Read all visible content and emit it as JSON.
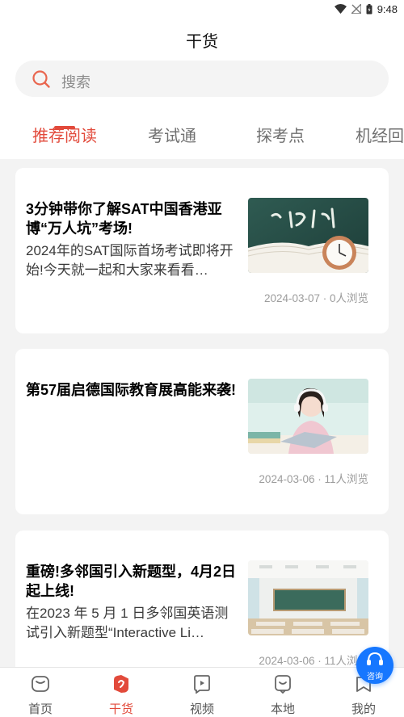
{
  "status_bar": {
    "time": "9:48"
  },
  "header": {
    "title": "干货"
  },
  "search": {
    "placeholder": "搜索"
  },
  "tabs": [
    {
      "label": "推荐阅读",
      "active": true
    },
    {
      "label": "考试通",
      "active": false
    },
    {
      "label": "探考点",
      "active": false
    },
    {
      "label": "机经回",
      "active": false
    }
  ],
  "articles": [
    {
      "title": "3分钟带你了解SAT中国香港亚博“万人坑”考场!",
      "desc": "2024年的SAT国际首场考试即将开始!今天就一起和大家来看看…",
      "meta": "2024-03-07 · 0人浏览",
      "thumb": "chalkboard-clock-image"
    },
    {
      "title": "第57届启德国际教育展高能来袭!",
      "desc": "",
      "meta": "2024-03-06 · 11人浏览",
      "thumb": "student-headphones-image"
    },
    {
      "title": "重磅!多邻国引入新题型，4月2日起上线!",
      "desc": "在2023 年 5 月 1 日多邻国英语测试引入新题型“Interactive Li…",
      "meta": "2024-03-06 · 11人浏览",
      "thumb": "classroom-image"
    }
  ],
  "bottom_nav": [
    {
      "label": "首页",
      "icon": "home-icon",
      "active": false
    },
    {
      "label": "干货",
      "icon": "dry-goods-icon",
      "active": true
    },
    {
      "label": "视频",
      "icon": "video-icon",
      "active": false
    },
    {
      "label": "本地",
      "icon": "local-icon",
      "active": false
    },
    {
      "label": "我的",
      "icon": "profile-icon",
      "active": false
    }
  ],
  "fab": {
    "label": "咨询",
    "icon": "headset-icon"
  },
  "colors": {
    "accent": "#e24a3b",
    "fab": "#1677ff"
  }
}
